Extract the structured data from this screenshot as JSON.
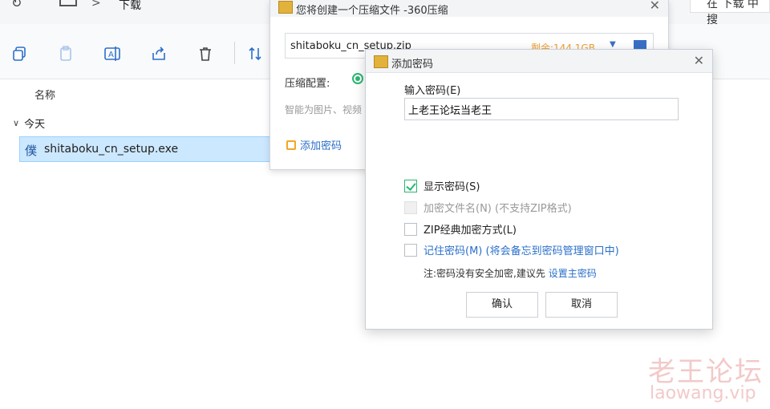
{
  "explorer": {
    "breadcrumb": ">",
    "folder": "下载",
    "search_text": "在 下载 中搜",
    "column_name": "名称",
    "group_label": "今天",
    "file_name": "shitaboku_cn_setup.exe",
    "toolbar_icons": [
      "copy-icon",
      "paste-icon",
      "rename-icon",
      "share-icon",
      "delete-icon",
      "sort-icon"
    ]
  },
  "zip_window": {
    "title": "您将创建一个压缩文件 -360压缩",
    "path_value": "shitaboku_cn_setup.zip",
    "remaining": "剩余:144.1GB",
    "config_label": "压缩配置:",
    "hint": "智能为图片、视频",
    "add_password": "添加密码"
  },
  "password_dialog": {
    "title": "添加密码",
    "input_label": "输入密码(E)",
    "password_value": "上老王论坛当老王",
    "options": [
      {
        "label": "显示密码(S)",
        "checked": true,
        "disabled": false
      },
      {
        "label": "加密文件名(N) (不支持ZIP格式)",
        "checked": false,
        "disabled": true
      },
      {
        "label": "ZIP经典加密方式(L)",
        "checked": false,
        "disabled": false
      },
      {
        "label": "记住密码(M) (将会备忘到密码管理窗口中)",
        "checked": false,
        "disabled": false
      }
    ],
    "note_prefix": "注:密码没有安全加密,建议先 ",
    "note_link": "设置主密码",
    "ok": "确认",
    "cancel": "取消"
  },
  "watermark": {
    "line1": "老王论坛",
    "line2": "laowang.vip"
  },
  "colors": {
    "accent_green": "#2bb673",
    "link_blue": "#2a6fc9",
    "selection": "#cce8ff",
    "warning_orange": "#f0a030"
  }
}
